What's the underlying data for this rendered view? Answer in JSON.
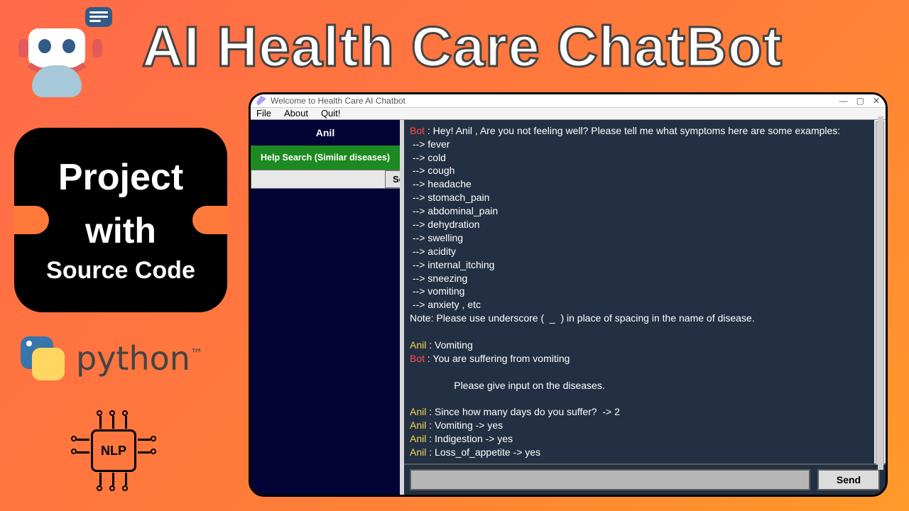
{
  "title": "AI Health Care ChatBot",
  "promo": {
    "line1": "Project",
    "line2": "with",
    "line3": "Source Code"
  },
  "python_label": "python",
  "nlp_label": "NLP",
  "window": {
    "title": "Welcome to Health Care AI Chatbot",
    "menu": {
      "file": "File",
      "about": "About",
      "quit": "Quit!"
    },
    "controls": {
      "min": "—",
      "max": "▢",
      "close": "✕"
    }
  },
  "sidebar": {
    "username": "Anil",
    "help_band": "Help Search (Similar diseases)",
    "search_placeholder": "",
    "search_button": "Search"
  },
  "chat": {
    "lines": [
      {
        "prefix": "Bot",
        "prefixClass": "clr-bot",
        "text": " : Hey! Anil , Are you not feeling well? Please tell me what symptoms here are some examples:"
      },
      {
        "text": " --> fever"
      },
      {
        "text": " --> cold"
      },
      {
        "text": " --> cough"
      },
      {
        "text": " --> headache"
      },
      {
        "text": " --> stomach_pain"
      },
      {
        "text": " --> abdominal_pain"
      },
      {
        "text": " --> dehydration"
      },
      {
        "text": " --> swelling"
      },
      {
        "text": " --> acidity"
      },
      {
        "text": " --> internal_itching"
      },
      {
        "text": " --> sneezing"
      },
      {
        "text": " --> vomiting"
      },
      {
        "text": " --> anxiety , etc"
      },
      {
        "text": "Note: Please use underscore (  _  ) in place of spacing in the name of disease."
      },
      {
        "text": " "
      },
      {
        "prefix": "Anil",
        "prefixClass": "clr-user",
        "text": " : Vomiting"
      },
      {
        "prefix": "Bot",
        "prefixClass": "clr-bot",
        "text": " : You are suffering from vomiting"
      },
      {
        "text": " "
      },
      {
        "text": "                Please give input on the diseases."
      },
      {
        "text": " "
      },
      {
        "prefix": "Anil",
        "prefixClass": "clr-user",
        "text": " : Since how many days do you suffer?  -> 2"
      },
      {
        "prefix": "Anil",
        "prefixClass": "clr-user",
        "text": " : Vomiting -> yes"
      },
      {
        "prefix": "Anil",
        "prefixClass": "clr-user",
        "text": " : Indigestion -> yes"
      },
      {
        "prefix": "Anil",
        "prefixClass": "clr-user",
        "text": " : Loss_of_appetite -> yes"
      }
    ],
    "input_value": "",
    "send_label": "Send"
  }
}
